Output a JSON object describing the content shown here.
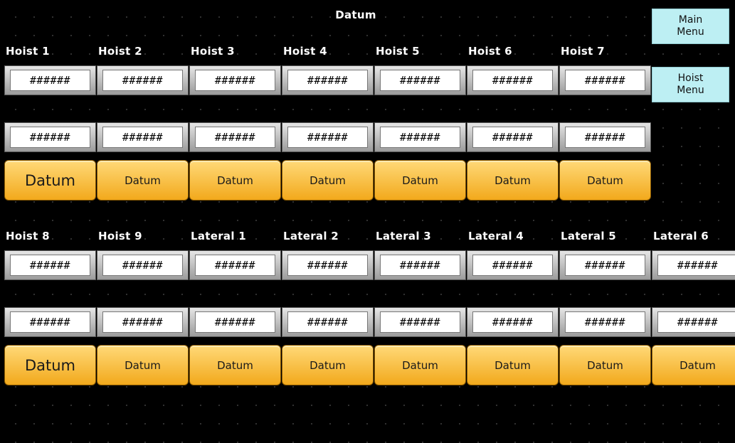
{
  "title": "Datum",
  "menu": {
    "main": "Main\nMenu",
    "hoist": "Hoist\nMenu"
  },
  "group_top": {
    "channels": [
      {
        "label": "Hoist 1",
        "value_1": "######",
        "value_2": "######",
        "button": "Datum"
      },
      {
        "label": "Hoist 2",
        "value_1": "######",
        "value_2": "######",
        "button": "Datum"
      },
      {
        "label": "Hoist 3",
        "value_1": "######",
        "value_2": "######",
        "button": "Datum"
      },
      {
        "label": "Hoist 4",
        "value_1": "######",
        "value_2": "######",
        "button": "Datum"
      },
      {
        "label": "Hoist 5",
        "value_1": "######",
        "value_2": "######",
        "button": "Datum"
      },
      {
        "label": "Hoist 6",
        "value_1": "######",
        "value_2": "######",
        "button": "Datum"
      },
      {
        "label": "Hoist 7",
        "value_1": "######",
        "value_2": "######",
        "button": "Datum"
      }
    ]
  },
  "group_bottom": {
    "channels": [
      {
        "label": "Hoist 8",
        "value_1": "######",
        "value_2": "######",
        "button": "Datum"
      },
      {
        "label": "Hoist 9",
        "value_1": "######",
        "value_2": "######",
        "button": "Datum"
      },
      {
        "label": "Lateral 1",
        "value_1": "######",
        "value_2": "######",
        "button": "Datum"
      },
      {
        "label": "Lateral 2",
        "value_1": "######",
        "value_2": "######",
        "button": "Datum"
      },
      {
        "label": "Lateral 3",
        "value_1": "######",
        "value_2": "######",
        "button": "Datum"
      },
      {
        "label": "Lateral 4",
        "value_1": "######",
        "value_2": "######",
        "button": "Datum"
      },
      {
        "label": "Lateral 5",
        "value_1": "######",
        "value_2": "######",
        "button": "Datum"
      },
      {
        "label": "Lateral 6",
        "value_1": "######",
        "value_2": "######",
        "button": "Datum"
      }
    ]
  },
  "colors": {
    "background": "#000000",
    "datum_button": "#f7b733",
    "menu_button": "#bdeff3"
  }
}
